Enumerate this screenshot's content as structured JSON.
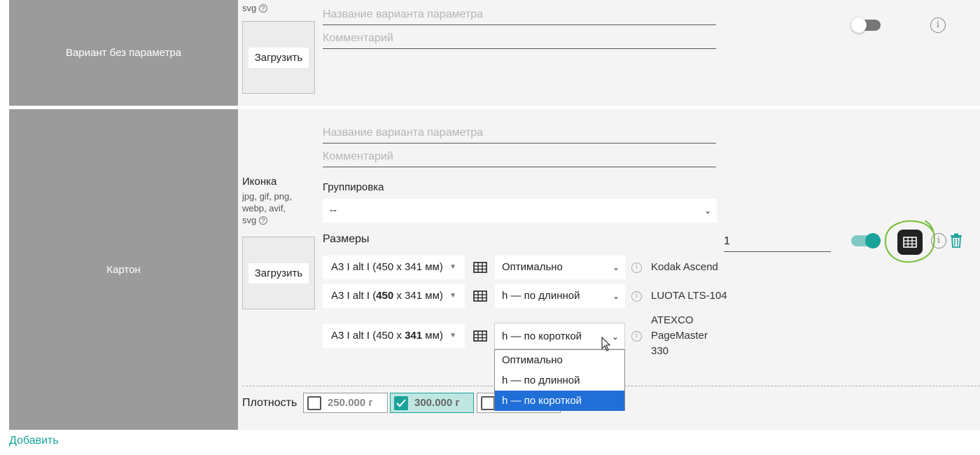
{
  "row1": {
    "label": "Вариант без параметра",
    "icon_formats_tail": "svg",
    "upload_label": "Загрузить",
    "name_placeholder": "Название варианта параметра",
    "comment_placeholder": "Комментарий",
    "enabled": false
  },
  "row2": {
    "label": "Картон",
    "icon_label": "Иконка",
    "icon_formats": [
      "jpg, gif, png,",
      "webp, avif,",
      "svg"
    ],
    "upload_label": "Загрузить",
    "name_placeholder": "Название варианта параметра",
    "comment_placeholder": "Комментарий",
    "grouping_label": "Группировка",
    "grouping_value": "--",
    "sizes_label": "Размеры",
    "quantity_value": "1",
    "enabled": true,
    "sizes": [
      {
        "size_prefix": "A3 I alt I (450 x 341 мм)",
        "size_bold": "",
        "orientation": "Оптимально",
        "printer": [
          "Kodak Ascend"
        ]
      },
      {
        "size_prefix": "A3 I alt I (",
        "size_bold": "450",
        "size_suffix": " x 341 мм)",
        "orientation": "h — по длинной",
        "printer": [
          "LUOTA LTS-104"
        ]
      },
      {
        "size_prefix": "A3 I alt I (450 x ",
        "size_bold": "341",
        "size_suffix": " мм)",
        "orientation": "h — по короткой",
        "printer": [
          "ATEXCO",
          "PageMaster",
          "330"
        ]
      }
    ],
    "orientation_options": [
      "Оптимально",
      "h — по длинной",
      "h — по короткой"
    ],
    "orientation_selected_option": "h — по короткой",
    "density_label": "Плотность",
    "density_options": [
      {
        "label": "250.000 г",
        "checked": false
      },
      {
        "label": "300.000 г",
        "checked": true
      },
      {
        "label": "",
        "checked": false
      }
    ]
  },
  "add_link": "Добавить",
  "colors": {
    "accent": "#1aa39a",
    "row_label_bg": "#9b9b9b",
    "selected_option": "#1f6fd6"
  }
}
